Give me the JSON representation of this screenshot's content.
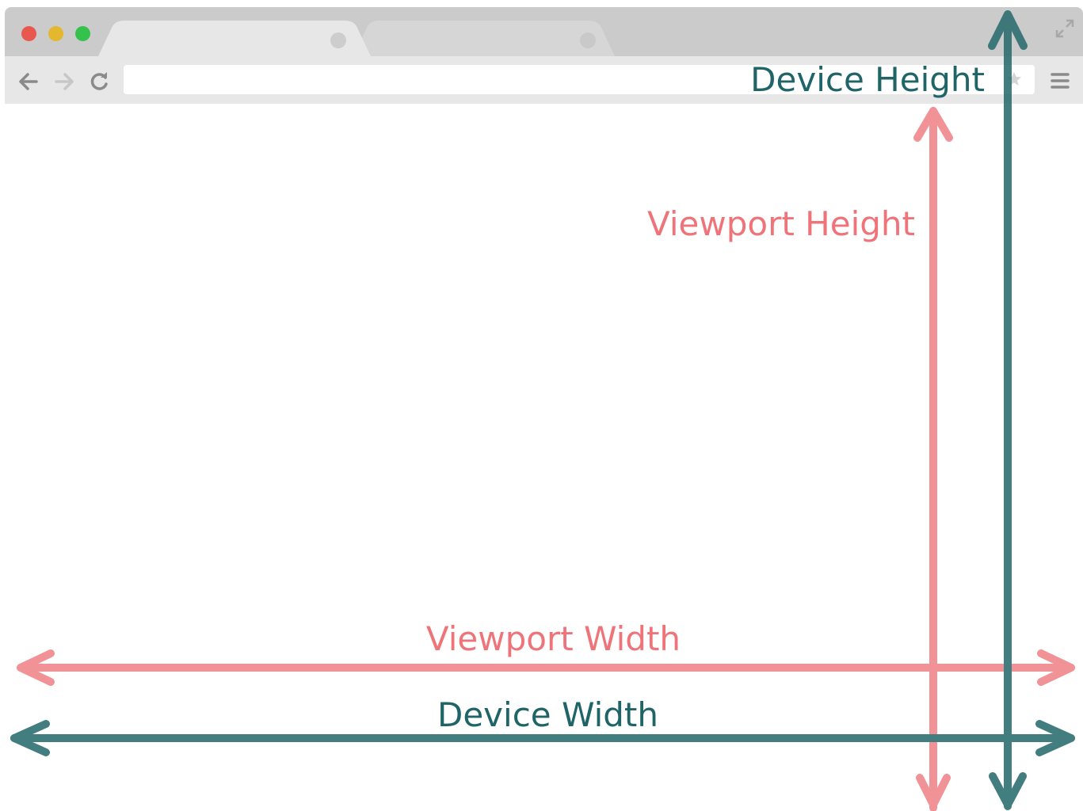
{
  "browser": {
    "window_controls": [
      "close",
      "minimize",
      "maximize"
    ],
    "tabs": [
      {
        "label": ""
      },
      {
        "label": ""
      }
    ],
    "address_bar": {
      "value": ""
    },
    "icons": {
      "back": "arrow-left-icon",
      "forward": "arrow-right-icon",
      "reload": "reload-icon",
      "bookmark": "star-icon",
      "menu": "hamburger-menu-icon",
      "fullscreen": "expand-icon"
    }
  },
  "labels": {
    "device_height": "Device Height",
    "viewport_height": "Viewport Height",
    "viewport_width": "Viewport Width",
    "device_width": "Device Width"
  },
  "colors": {
    "device": "#2e6f72",
    "viewport": "#f0878b",
    "chrome": "#cbcbcb"
  }
}
